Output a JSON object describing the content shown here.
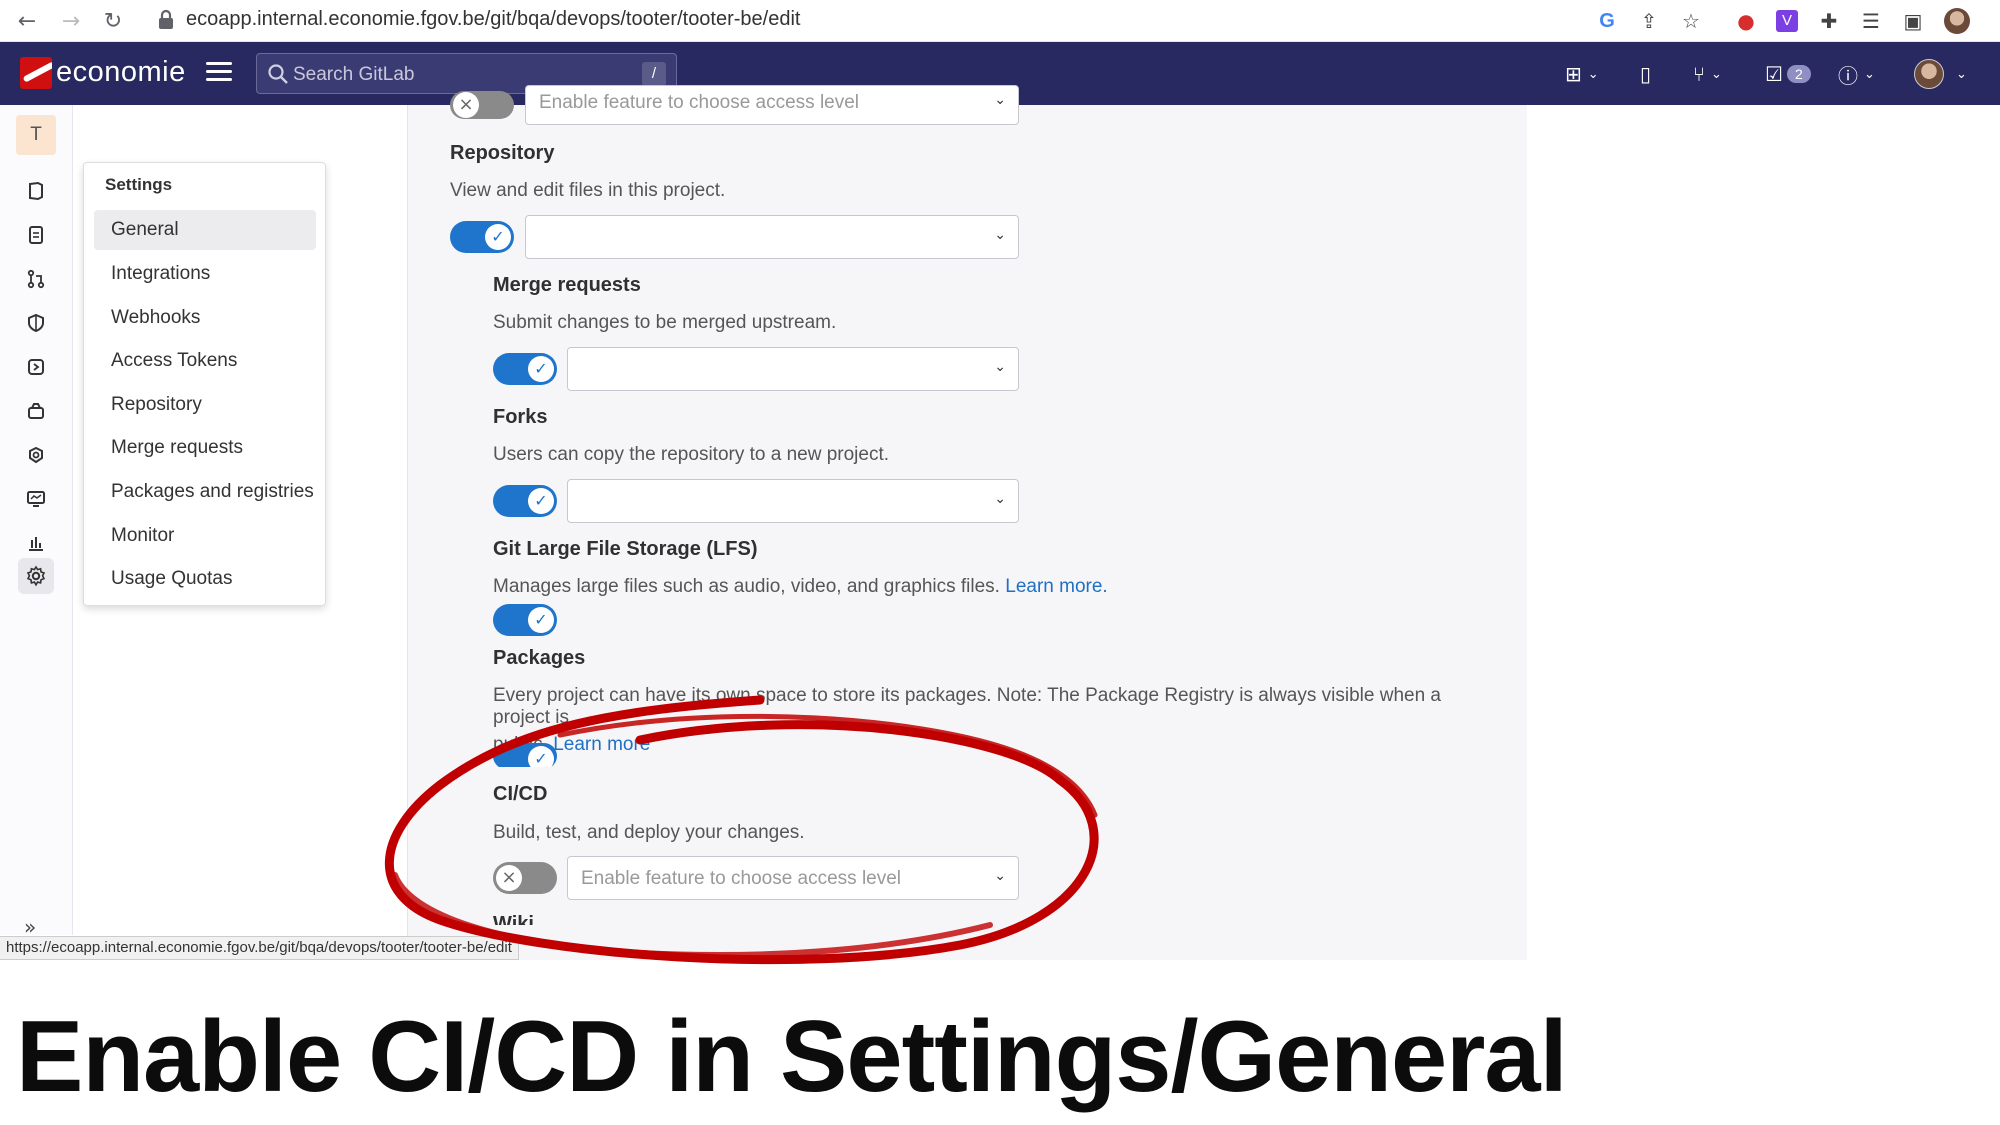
{
  "browser": {
    "url": "ecoapp.internal.economie.fgov.be/git/bqa/devops/tooter/tooter-be/edit",
    "status_url": "https://ecoapp.internal.economie.fgov.be/git/bqa/devops/tooter/tooter-be/edit"
  },
  "gitlab_header": {
    "brand": "economie",
    "search_placeholder": "Search GitLab",
    "search_shortcut": "/",
    "todo_count": "2"
  },
  "sidebar": {
    "project_initial": "T"
  },
  "flyout": {
    "title": "Settings",
    "items": [
      "General",
      "Integrations",
      "Webhooks",
      "Access Tokens",
      "Repository",
      "Merge requests",
      "Packages and registries",
      "Monitor",
      "Usage Quotas"
    ],
    "selected": "General"
  },
  "content": {
    "top_partial_placeholder": "Enable feature to choose access level",
    "repository": {
      "title": "Repository",
      "desc": "View and edit files in this project.",
      "enabled": true
    },
    "merge_requests": {
      "title": "Merge requests",
      "desc": "Submit changes to be merged upstream.",
      "enabled": true
    },
    "forks": {
      "title": "Forks",
      "desc": "Users can copy the repository to a new project.",
      "enabled": true
    },
    "lfs": {
      "title": "Git Large File Storage (LFS)",
      "desc": "Manages large files such as audio, video, and graphics files.",
      "link": "Learn more.",
      "enabled": true
    },
    "packages": {
      "title": "Packages",
      "desc_line1": "Every project can have its own space to store its packages. Note: The Package Registry is always visible when a project is",
      "desc_line2": "public.",
      "link": "Learn more",
      "enabled": true
    },
    "cicd": {
      "title": "CI/CD",
      "desc": "Build, test, and deploy your changes.",
      "placeholder": "Enable feature to choose access level",
      "enabled": false
    },
    "next_partial": "Wiki"
  },
  "caption": "Enable CI/CD in Settings/General",
  "colors": {
    "gitlab_header": "#292961",
    "toggle_on": "#1f75cb",
    "annotation": "#c00000"
  }
}
